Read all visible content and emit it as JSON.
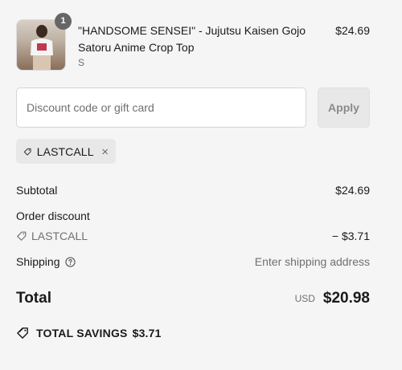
{
  "cart_item": {
    "quantity": "1",
    "title": "\"HANDSOME SENSEI\" - Jujutsu Kaisen Gojo Satoru Anime Crop Top",
    "variant": "S",
    "price": "$24.69",
    "image_icon": "product-photo"
  },
  "discount": {
    "placeholder": "Discount code or gift card",
    "value": "",
    "apply_label": "Apply",
    "applied_code": "LASTCALL"
  },
  "summary": {
    "subtotal_label": "Subtotal",
    "subtotal_value": "$24.69",
    "order_discount_label": "Order discount",
    "discount_code": "LASTCALL",
    "discount_value": "− $3.71",
    "shipping_label": "Shipping",
    "shipping_value": "Enter shipping address",
    "total_label": "Total",
    "total_currency": "USD",
    "total_value": "$20.98"
  },
  "savings": {
    "label": "TOTAL SAVINGS",
    "value": "$3.71"
  },
  "colors": {
    "background": "#f5f5f5",
    "text": "#1a1a1a",
    "muted": "#707070",
    "badge": "#666666",
    "chip": "#e8e8e8"
  }
}
